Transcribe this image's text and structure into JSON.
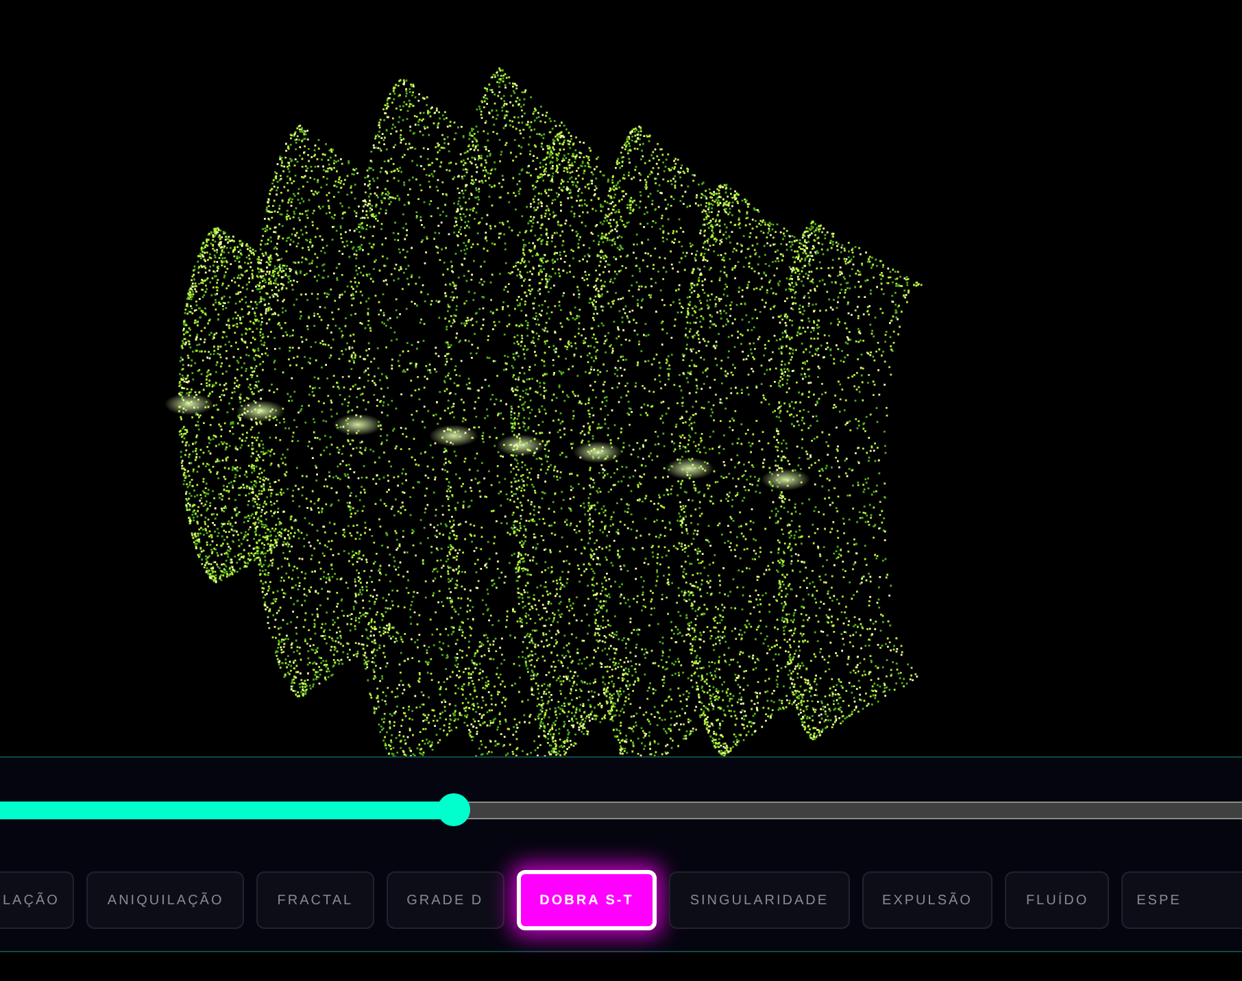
{
  "slider": {
    "level": 0.365
  },
  "modes": [
    {
      "label": "LAÇÃO",
      "selected": false
    },
    {
      "label": "ANIQUILAÇÃO",
      "selected": false
    },
    {
      "label": "FRACTAL",
      "selected": false
    },
    {
      "label": "GRADE D",
      "selected": false
    },
    {
      "label": "DOBRA S-T",
      "selected": true
    },
    {
      "label": "SINGULARIDADE",
      "selected": false
    },
    {
      "label": "EXPULSÃO",
      "selected": false
    },
    {
      "label": "FLUÍDO",
      "selected": false
    },
    {
      "label": "ESPE",
      "selected": false
    }
  ]
}
